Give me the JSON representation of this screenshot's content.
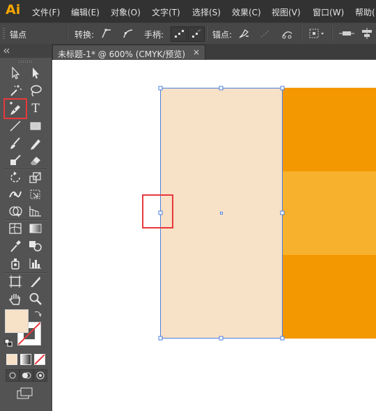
{
  "app": {
    "logo": "Ai",
    "brand_color": "#f7a600"
  },
  "menu": {
    "items": [
      "文件(F)",
      "编辑(E)",
      "对象(O)",
      "文字(T)",
      "选择(S)",
      "效果(C)",
      "视图(V)",
      "窗口(W)",
      "帮助("
    ]
  },
  "control_bar": {
    "mode_label": "锚点",
    "convert_label": "转换:",
    "handles_label": "手柄:",
    "anchor_label": "锚点:"
  },
  "document": {
    "tab_title": "未标题-1* @ 600% (CMYK/预览)",
    "close_glyph": "×"
  },
  "tools": {
    "selected": "add-anchor-point-tool",
    "type_glyph": "T"
  },
  "colors": {
    "fill": "#f7e1c7",
    "orange_dark": "#f39800",
    "orange_light": "#f8b12c",
    "selection": "#4a7fe0",
    "highlight": "#e8383c"
  }
}
